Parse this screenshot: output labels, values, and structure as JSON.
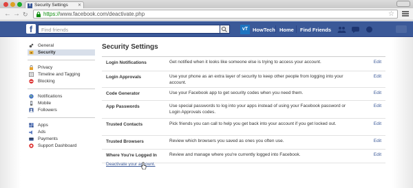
{
  "browser": {
    "tab_title": "Security Settings",
    "tab_favicon": "f",
    "url_scheme": "https://",
    "url_rest": "www.facebook.com/deactivate.php",
    "icons": [
      "back-arrow-icon",
      "forward-arrow-icon",
      "refresh-icon",
      "lock-icon",
      "star-icon",
      "menu-icon"
    ]
  },
  "fbbar": {
    "logo": "f",
    "search_placeholder": "Find friends",
    "profile_initials": "vT",
    "profile_name": "HowTech",
    "nav_home": "Home",
    "nav_find_friends": "Find Friends",
    "colors": {
      "bar": "#3b5998",
      "link": "#3b5998"
    }
  },
  "sidebar": {
    "group1": [
      {
        "label": "General",
        "icon": "gear-icon",
        "active": false
      },
      {
        "label": "Security",
        "icon": "security-icon",
        "active": true
      }
    ],
    "group2": [
      {
        "label": "Privacy",
        "icon": "lock-icon"
      },
      {
        "label": "Timeline and Tagging",
        "icon": "timeline-icon"
      },
      {
        "label": "Blocking",
        "icon": "blocking-icon"
      }
    ],
    "group3": [
      {
        "label": "Notifications",
        "icon": "globe-icon"
      },
      {
        "label": "Mobile",
        "icon": "mobile-icon"
      },
      {
        "label": "Followers",
        "icon": "followers-icon"
      }
    ],
    "group4": [
      {
        "label": "Apps",
        "icon": "apps-icon"
      },
      {
        "label": "Ads",
        "icon": "ads-icon"
      },
      {
        "label": "Payments",
        "icon": "payments-icon"
      },
      {
        "label": "Support Dashboard",
        "icon": "support-icon"
      }
    ]
  },
  "main": {
    "title": "Security Settings",
    "rows": [
      {
        "label": "Login Notifications",
        "desc": "Get notified when it looks like someone else is trying to access your account.",
        "edit": "Edit"
      },
      {
        "label": "Login Approvals",
        "desc": "Use your phone as an extra layer of security to keep other people from logging into your account.",
        "edit": "Edit"
      },
      {
        "label": "Code Generator",
        "desc": "Use your Facebook app to get security codes when you need them.",
        "edit": "Edit"
      },
      {
        "label": "App Passwords",
        "desc": "Use special passwords to log into your apps instead of using your Facebook password or Login Approvals codes.",
        "edit": "Edit"
      },
      {
        "label": "Trusted Contacts",
        "desc": "Pick friends you can call to help you get back into your account if you get locked out.",
        "edit": "Edit"
      },
      {
        "label": "Trusted Browsers",
        "desc": "Review which browsers you saved as ones you often use.",
        "edit": "Edit"
      },
      {
        "label": "Where You're Logged In",
        "desc": "Review and manage where you're currently logged into Facebook.",
        "edit": "Edit"
      }
    ],
    "deactivate_link": "Deactivate your account."
  }
}
